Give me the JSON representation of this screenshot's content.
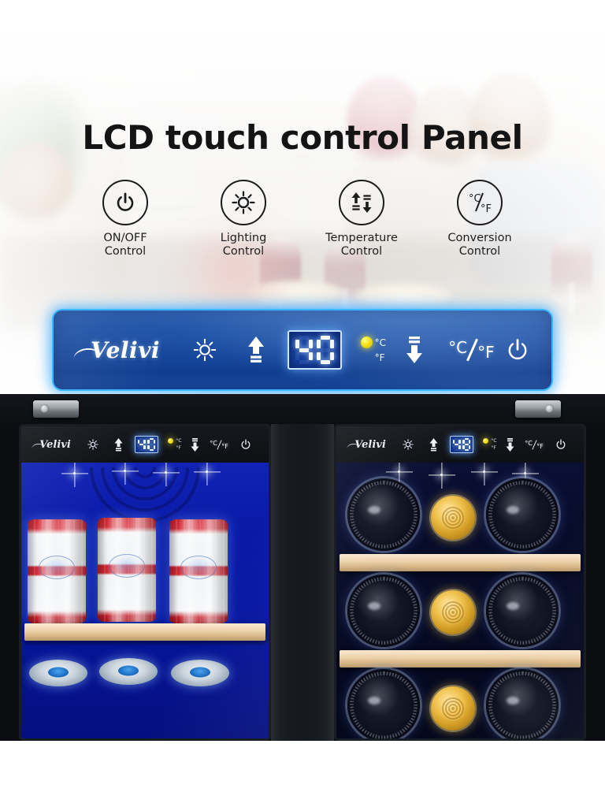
{
  "page": {
    "title": "LCD touch control Panel",
    "brand": "Velivi"
  },
  "features": [
    {
      "label_line1": "ON/OFF",
      "label_line2": "Control",
      "icon": "power-icon"
    },
    {
      "label_line1": "Lighting",
      "label_line2": "Control",
      "icon": "sun-icon"
    },
    {
      "label_line1": "Temperature",
      "label_line2": "Control",
      "icon": "up-down-arrows-icon"
    },
    {
      "label_line1": "Conversion",
      "label_line2": "Control",
      "icon": "celsius-fahrenheit-icon"
    }
  ],
  "control_panel": {
    "brand": "Velivi",
    "display_value": "40",
    "unit_celsius": "°C",
    "unit_fahrenheit": "°F",
    "celsius_led": "active",
    "fahrenheit_led": "inactive",
    "conversion_c": "°C",
    "conversion_slash": "/",
    "conversion_f": "°F",
    "buttons": [
      "light-button",
      "temp-up-button",
      "temp-down-button",
      "unit-conversion-button",
      "power-button"
    ],
    "accent_color": "#39b7ff",
    "panel_color": "#17489d",
    "led_on_color": "#f2e017",
    "led_off_color": "#135f3c"
  },
  "appliance": {
    "left_zone": {
      "brand": "Velivi",
      "display_value": "40",
      "unit_celsius": "°C",
      "unit_fahrenheit": "°F",
      "conversion_c": "°C",
      "conversion_f": "°F",
      "contents": "beverage-cans"
    },
    "right_zone": {
      "brand": "Velivi",
      "display_value": "48",
      "unit_celsius": "°C",
      "unit_fahrenheit": "°F",
      "conversion_c": "°C",
      "conversion_f": "°F",
      "contents": "wine-bottles"
    }
  }
}
